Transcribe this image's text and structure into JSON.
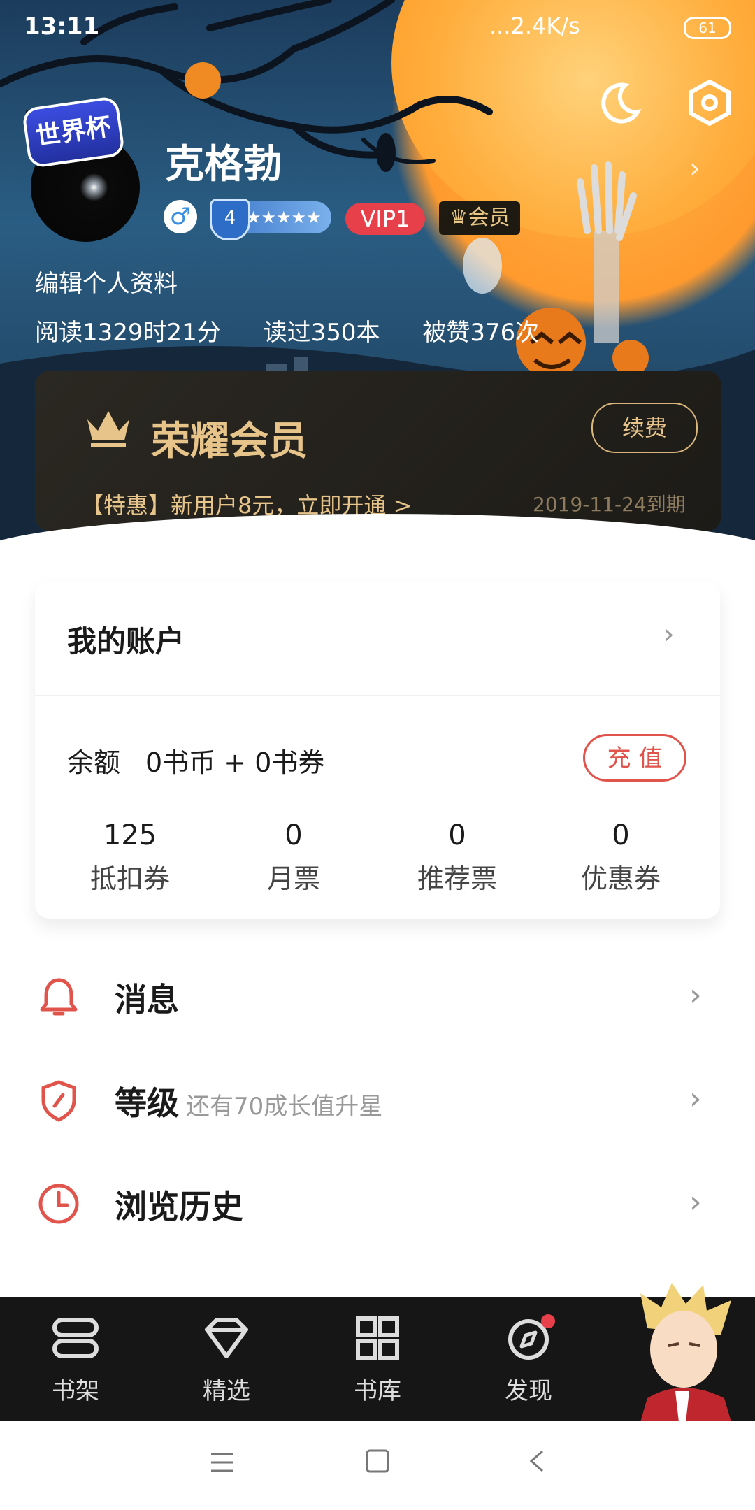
{
  "status_bar": {
    "time": "13:11",
    "network": "...2.4K/s",
    "battery": "61"
  },
  "profile": {
    "username": "克格勃",
    "badge_worldcup": "世界杯",
    "level_number": "4",
    "level_stars": "★★★★★",
    "vip": "VIP1",
    "member_tag": "会员",
    "edit_label": "编辑个人资料",
    "stats": {
      "read_time": "阅读1329时21分",
      "books_read": "读过350本",
      "likes": "被赞376次"
    }
  },
  "membership": {
    "title": "荣耀会员",
    "renew_label": "续费",
    "promo": "【特惠】新用户8元，立即开通 >",
    "expire": "2019-11-24到期"
  },
  "account": {
    "title": "我的账户",
    "balance_label": "余额",
    "balance_value": "0书币 + 0书券",
    "recharge_label": "充 值",
    "counters": [
      {
        "value": "125",
        "label": "抵扣券"
      },
      {
        "value": "0",
        "label": "月票"
      },
      {
        "value": "0",
        "label": "推荐票"
      },
      {
        "value": "0",
        "label": "优惠券"
      }
    ]
  },
  "menu": [
    {
      "label": "消息",
      "icon": "bell-icon"
    },
    {
      "label": "等级",
      "sub": "还有70成长值升星",
      "icon": "shield-icon"
    },
    {
      "label": "浏览历史",
      "icon": "clock-icon"
    }
  ],
  "nav": [
    {
      "label": "书架",
      "icon": "bookshelf-icon"
    },
    {
      "label": "精选",
      "icon": "diamond-icon"
    },
    {
      "label": "书库",
      "icon": "grid-icon"
    },
    {
      "label": "发现",
      "icon": "compass-icon"
    }
  ],
  "colors": {
    "accent": "#e0544c",
    "gold": "#e7c48a",
    "vip_red": "#e8404a"
  }
}
